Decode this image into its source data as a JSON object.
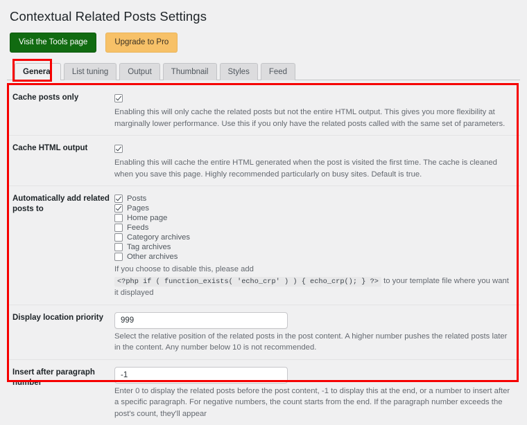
{
  "header": {
    "title": "Contextual Related Posts Settings",
    "buttons": [
      {
        "label": "Visit the Tools page",
        "name": "visit-tools-page-button",
        "color": "#116b11"
      },
      {
        "label": "Upgrade to Pro",
        "name": "upgrade-to-pro-button",
        "color": "#f7c168"
      }
    ]
  },
  "tabs": {
    "active": "General",
    "items": [
      {
        "label": "General"
      },
      {
        "label": "List tuning"
      },
      {
        "label": "Output"
      },
      {
        "label": "Thumbnail"
      },
      {
        "label": "Styles"
      },
      {
        "label": "Feed"
      }
    ]
  },
  "settings": {
    "cache_posts_only": {
      "label": "Cache posts only",
      "checked": true,
      "description": "Enabling this will only cache the related posts but not the entire HTML output. This gives you more flexibility at marginally lower performance. Use this if you only have the related posts called with the same set of parameters."
    },
    "cache_html_output": {
      "label": "Cache HTML output",
      "checked": true,
      "description": "Enabling this will cache the entire HTML generated when the post is visited the first time. The cache is cleaned when you save this page. Highly recommended particularly on busy sites. Default is true."
    },
    "auto_add": {
      "label": "Automatically add related posts to",
      "options": [
        {
          "label": "Posts",
          "checked": true
        },
        {
          "label": "Pages",
          "checked": true
        },
        {
          "label": "Home page",
          "checked": false
        },
        {
          "label": "Feeds",
          "checked": false
        },
        {
          "label": "Category archives",
          "checked": false
        },
        {
          "label": "Tag archives",
          "checked": false
        },
        {
          "label": "Other archives",
          "checked": false
        }
      ],
      "description_before": "If you choose to disable this, please add",
      "description_code": "<?php if ( function_exists( 'echo_crp' ) ) { echo_crp(); } ?>",
      "description_after": "to your template file where you want it displayed"
    },
    "display_priority": {
      "label": "Display location priority",
      "value": "999",
      "placeholder": "",
      "description": "Select the relative position of the related posts in the post content. A higher number pushes the related posts later in the content. Any number below 10 is not recommended."
    },
    "insert_after_paragraph": {
      "label": "Insert after paragraph number",
      "value": "-1",
      "placeholder": "",
      "description": "Enter 0 to display the related posts before the post content, -1 to display this at the end, or a number to insert after a specific paragraph. For negative numbers, the count starts from the end. If the paragraph number exceeds the post's count, they'll appear"
    }
  },
  "annotations": {
    "color": "#f60000",
    "tab_highlight": "General",
    "panel_highlight": "settings-panel"
  }
}
